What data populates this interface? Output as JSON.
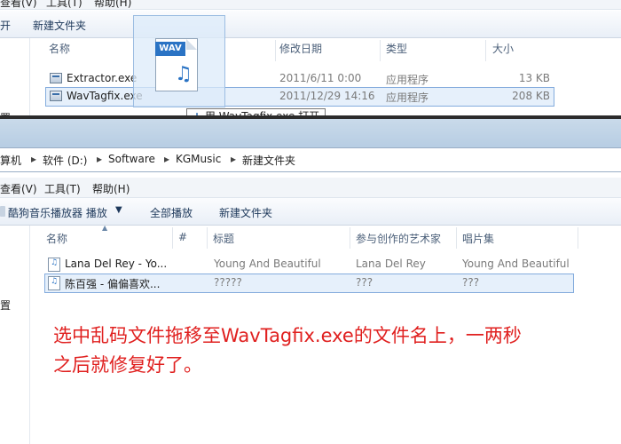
{
  "top_window": {
    "menu": [
      "查看(V)",
      "工具(T)",
      "帮助(H)"
    ],
    "toolbar": {
      "open_label": "开",
      "new_folder_label": "新建文件夹"
    },
    "columns": {
      "name": "名称",
      "modified": "修改日期",
      "type": "类型",
      "size": "大小"
    },
    "files": [
      {
        "name": "Extractor.exe",
        "modified": "2011/6/11 0:00",
        "type": "应用程序",
        "size": "13 KB"
      },
      {
        "name": "WavTagfix.exe",
        "modified": "2011/12/29 14:16",
        "type": "应用程序",
        "size": "208 KB"
      }
    ],
    "left_fragment": "置",
    "drag_icon_label": "WAV",
    "drag_tooltip": "用 WavTagfix.exe 打开"
  },
  "bottom_window": {
    "breadcrumb": [
      "算机",
      "软件 (D:)",
      "Software",
      "KGMusic",
      "新建文件夹"
    ],
    "menu": [
      "查看(V)",
      "工具(T)",
      "帮助(H)"
    ],
    "toolbar": {
      "play_with": "酷狗音乐播放器 播放",
      "play_all": "全部播放",
      "new_folder": "新建文件夹"
    },
    "columns": {
      "name": "名称",
      "number": "#",
      "title": "标题",
      "artist": "参与创作的艺术家",
      "album": "唱片集"
    },
    "files": [
      {
        "name": "Lana Del Rey - Yo...",
        "title": "Young And Beautiful",
        "artist": "Lana Del Rey",
        "album": "Young And Beautiful"
      },
      {
        "name": "陈百强 - 偏偏喜欢...",
        "title": "?????",
        "artist": "???",
        "album": "???"
      }
    ],
    "left_fragment": "置"
  },
  "annotation": {
    "line1": "选中乱码文件拖移至WavTagfix.exe的文件名上，一两秒",
    "line2": "之后就修复好了。"
  },
  "colors": {
    "selection": "#e6f0fb",
    "annotation_red": "#e0201f"
  }
}
